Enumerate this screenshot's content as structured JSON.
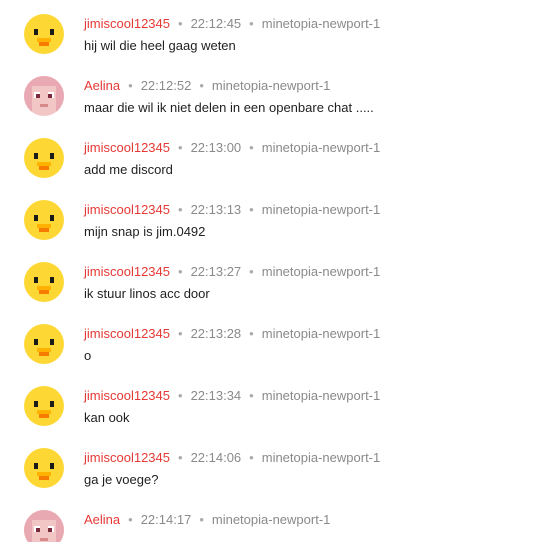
{
  "colors": {
    "username": "#e53935",
    "meta": "#8a8a8a",
    "text": "#1f1f1f",
    "duck_yellow": "#fdd835",
    "duck_beak": "#f57c00"
  },
  "messages": [
    {
      "user": "jimiscool12345",
      "time": "22:12:45",
      "server": "minetopia-newport-1",
      "text": "hij wil die heel gaag weten",
      "avatar": "duck-avatar-icon"
    },
    {
      "user": "Aelina",
      "time": "22:12:52",
      "server": "minetopia-newport-1",
      "text": "maar die wil ik niet delen in een openbare chat .....",
      "avatar": "pixel-face-avatar-icon"
    },
    {
      "user": "jimiscool12345",
      "time": "22:13:00",
      "server": "minetopia-newport-1",
      "text": "add me discord",
      "avatar": "duck-avatar-icon"
    },
    {
      "user": "jimiscool12345",
      "time": "22:13:13",
      "server": "minetopia-newport-1",
      "text": "mijn snap is jim.0492",
      "avatar": "duck-avatar-icon"
    },
    {
      "user": "jimiscool12345",
      "time": "22:13:27",
      "server": "minetopia-newport-1",
      "text": "ik stuur linos acc door",
      "avatar": "duck-avatar-icon"
    },
    {
      "user": "jimiscool12345",
      "time": "22:13:28",
      "server": "minetopia-newport-1",
      "text": "o",
      "avatar": "duck-avatar-icon"
    },
    {
      "user": "jimiscool12345",
      "time": "22:13:34",
      "server": "minetopia-newport-1",
      "text": "kan ook",
      "avatar": "duck-avatar-icon"
    },
    {
      "user": "jimiscool12345",
      "time": "22:14:06",
      "server": "minetopia-newport-1",
      "text": "ga je voege?",
      "avatar": "duck-avatar-icon"
    },
    {
      "user": "Aelina",
      "time": "22:14:17",
      "server": "minetopia-newport-1",
      "text": "",
      "avatar": "pixel-face-avatar-icon"
    }
  ],
  "separator": "•"
}
